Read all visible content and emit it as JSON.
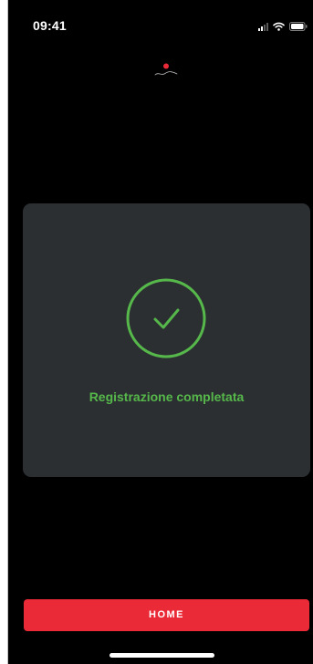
{
  "status_bar": {
    "time": "09:41",
    "icons": [
      "cellular-signal-icon",
      "wifi-icon",
      "battery-icon"
    ]
  },
  "header": {
    "logo_icon": "lamborghini-logo-icon"
  },
  "card": {
    "icon": "check-circle-icon",
    "message": "Registrazione completata"
  },
  "actions": {
    "home_label": "HOME"
  },
  "colors": {
    "background": "#000000",
    "card": "#2b2f32",
    "success": "#56b84a",
    "accent": "#ea2a36",
    "text": "#ffffff"
  }
}
